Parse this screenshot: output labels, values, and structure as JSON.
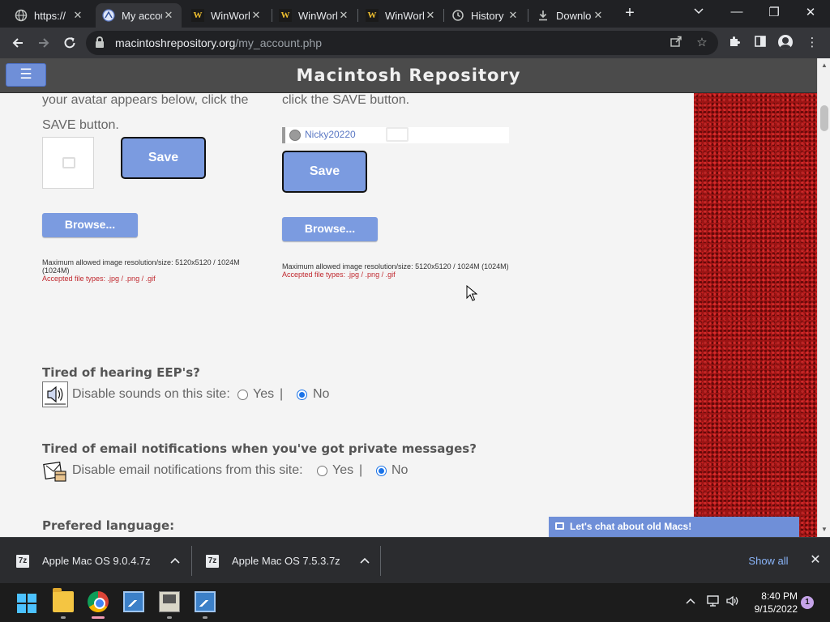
{
  "browser": {
    "tabs": [
      {
        "title": "https://",
        "icon": "globe-icon"
      },
      {
        "title": "My account",
        "icon": "site-favicon",
        "active": true
      },
      {
        "title": "WinWorld",
        "icon": "winworld-icon"
      },
      {
        "title": "WinWorld",
        "icon": "winworld-icon"
      },
      {
        "title": "WinWorld",
        "icon": "winworld-icon"
      },
      {
        "title": "History",
        "icon": "history-icon"
      },
      {
        "title": "Downloads",
        "icon": "download-icon"
      }
    ],
    "url_host": "macintoshrepository.org",
    "url_path": "/my_account.php"
  },
  "site": {
    "title": "Macintosh Repository",
    "left_avatar_text_1": "your avatar appears below, click the",
    "left_avatar_text_2": "SAVE button.",
    "right_avatar_text": "click the SAVE button.",
    "save_label": "Save",
    "browse_label": "Browse...",
    "username": "Nicky20220",
    "max_size_note": "Maximum allowed image resolution/size: 5120x5120 / 1024M (1024M)",
    "max_size_note_left_1": "Maximum allowed image resolution/size: 5120x5120 / 1024M",
    "max_size_note_left_2": "(1024M)",
    "accepted_types": "Accepted file types: .jpg / .png / .gif",
    "sounds_heading": "Tired of hearing EEP's?",
    "sounds_label": "Disable sounds on this site:",
    "email_heading": "Tired of email notifications when you've got private messages?",
    "email_label": "Disable email notifications from this site:",
    "yes": "Yes",
    "no": "No",
    "separator": "|",
    "sounds_selected": "No",
    "email_selected": "No",
    "language_heading": "Prefered language:",
    "chat_label": "Let's chat about old Macs!",
    "accent_color": "#7b9be0"
  },
  "downloads": {
    "items": [
      "Apple Mac OS 9.0.4.7z",
      "Apple Mac OS 7.5.3.7z"
    ],
    "show_all": "Show all"
  },
  "taskbar": {
    "time": "8:40 PM",
    "date": "9/15/2022",
    "notifications": "1"
  }
}
